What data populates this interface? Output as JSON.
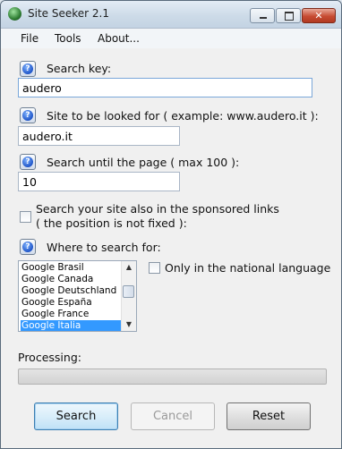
{
  "window": {
    "title": "Site Seeker 2.1",
    "controls": {
      "minimize": "minimize",
      "maximize": "maximize",
      "close": "✕"
    }
  },
  "menu": {
    "items": [
      "File",
      "Tools",
      "About..."
    ]
  },
  "form": {
    "search_key": {
      "label": "Search key:",
      "value": "audero"
    },
    "site": {
      "label": "Site to be looked for ( example: www.audero.it ):",
      "value": "audero.it"
    },
    "max_page": {
      "label": "Search until the page ( max 100 ):",
      "value": "10"
    },
    "sponsored": {
      "line1": "Search your site also in the sponsored links",
      "line2": "( the position is not fixed ):",
      "checked": false
    },
    "where": {
      "label": "Where to search for:",
      "options": [
        "Google Brasil",
        "Google Canada",
        "Google Deutschland",
        "Google España",
        "Google France",
        "Google Italia"
      ],
      "selected": "Google Italia"
    },
    "national_language": {
      "label": "Only in the national language",
      "checked": false
    }
  },
  "status": {
    "processing_label": "Processing:",
    "progress": 0
  },
  "buttons": {
    "search": "Search",
    "cancel": "Cancel",
    "reset": "Reset"
  },
  "icons": {
    "help": "help-icon",
    "app": "app-icon"
  }
}
